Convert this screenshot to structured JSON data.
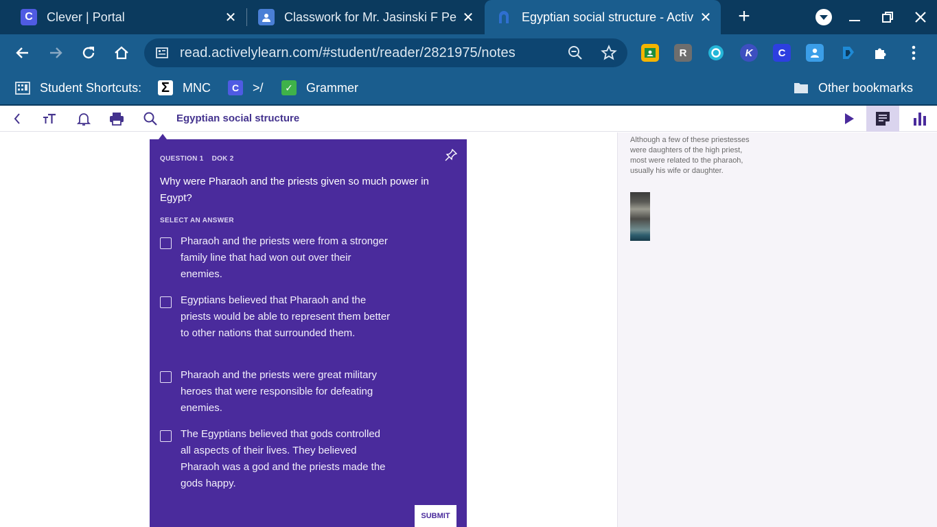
{
  "browser": {
    "tabs": [
      {
        "title": "Clever | Portal",
        "favicon": "C",
        "favicon_color": "#4f5be3"
      },
      {
        "title": "Classwork for Mr. Jasinski F Pe",
        "favicon": "person",
        "favicon_color": "#4a7fd6"
      },
      {
        "title": "Egyptian social structure - Activ",
        "favicon": "A",
        "favicon_color": "#2f6fd0"
      }
    ],
    "url": "read.activelylearn.com/#student/reader/2821975/notes",
    "extensions": [
      {
        "name": "classroom-ext",
        "glyph": "▣",
        "color": "#f4b400"
      },
      {
        "name": "r-ext",
        "glyph": "R",
        "color": "#6e6e6e"
      },
      {
        "name": "shield-ext",
        "glyph": "◎",
        "color": "#25b6d8"
      },
      {
        "name": "k-ext",
        "glyph": "K",
        "color": "#3d4fc0"
      },
      {
        "name": "c-ext",
        "glyph": "C",
        "color": "#2d3fe0"
      },
      {
        "name": "classroom2-ext",
        "glyph": "▲",
        "color": "#3b9ee8"
      },
      {
        "name": "drop-ext",
        "glyph": "◆",
        "color": "#1e8ad6"
      }
    ],
    "bookmarks": [
      {
        "label": "Student Shortcuts:",
        "icon": "apps-icon"
      },
      {
        "label": "MNC",
        "icon": "sigma-icon"
      },
      {
        "label": ">/",
        "icon": "c-icon"
      },
      {
        "label": "Grammer",
        "icon": "check-icon"
      }
    ],
    "other_bookmarks": "Other bookmarks"
  },
  "app": {
    "title": "Egyptian social structure",
    "accent": "#4a2b9c"
  },
  "question": {
    "number_label": "QUESTION 1",
    "dok_label": "DOK 2",
    "prompt": "Why were Pharaoh and the priests given so much power in Egypt?",
    "select_label": "SELECT AN ANSWER",
    "options": [
      "Pharaoh and the priests were from a stronger family line that had won out over their enemies.",
      "Egyptians believed that Pharaoh and the priests would be able to represent them better to other nations that surrounded them.",
      "Pharaoh and the priests were great military heroes that were responsible for defeating enemies.",
      "The Egyptians believed that gods controlled all aspects of their lives. They believed Pharaoh was a god and the priests made the gods happy."
    ],
    "submit_label": "SUBMIT"
  },
  "side_panel": {
    "text": "Although a few of these priestesses were daughters of the high priest, most were related to the pharaoh, usually his wife or daughter."
  }
}
